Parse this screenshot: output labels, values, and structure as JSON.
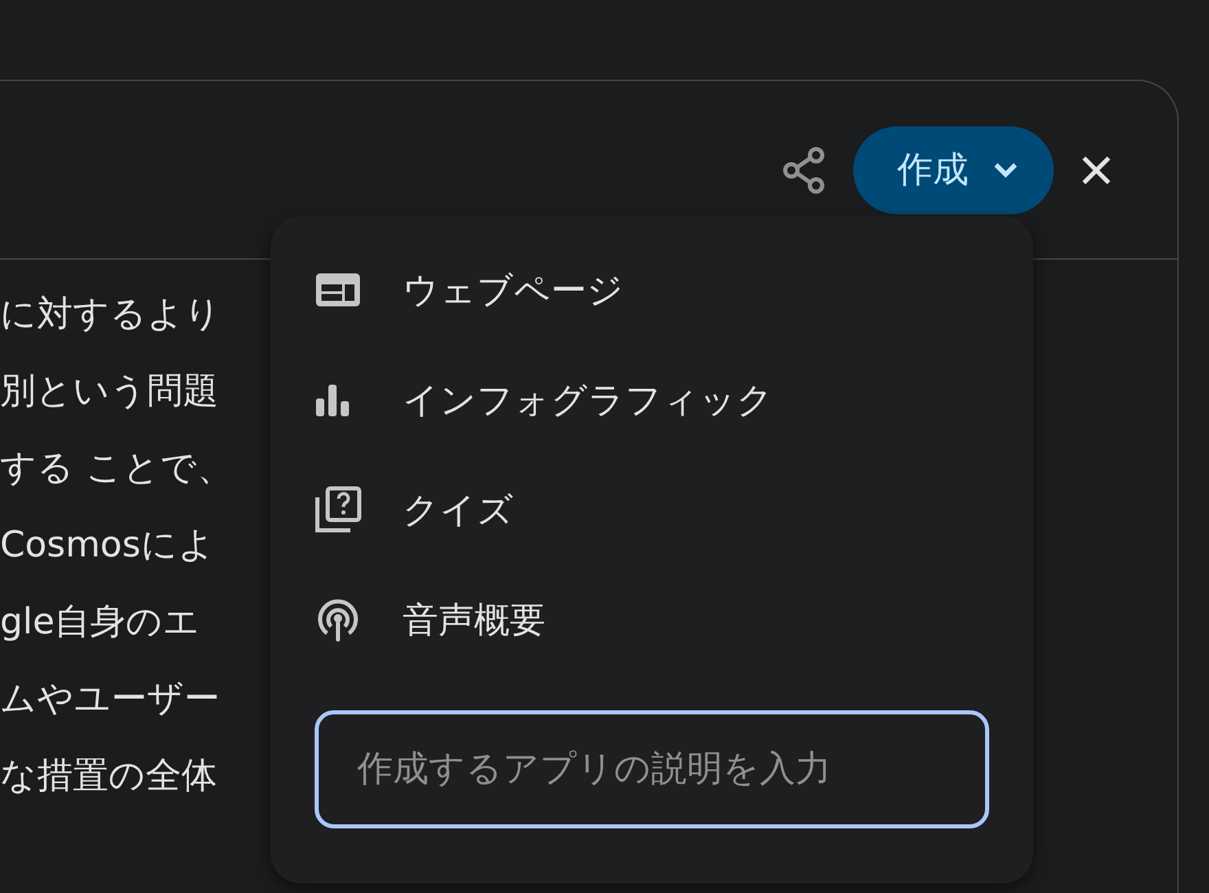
{
  "header": {
    "create_button": {
      "label": "作成"
    }
  },
  "body_lines": [
    "に対するより",
    "別という問題",
    "する ことで、",
    "Cosmosによ",
    "gle自身のエ",
    "ムやユーザー",
    "な措置の全体"
  ],
  "create_menu": {
    "items": [
      {
        "kind": "webpage",
        "label": "ウェブページ"
      },
      {
        "kind": "infographic",
        "label": "インフォグラフィック"
      },
      {
        "kind": "quiz",
        "label": "クイズ"
      },
      {
        "kind": "audio",
        "label": "音声概要"
      }
    ],
    "prompt_field": {
      "placeholder": "作成するアプリの説明を入力"
    }
  }
}
